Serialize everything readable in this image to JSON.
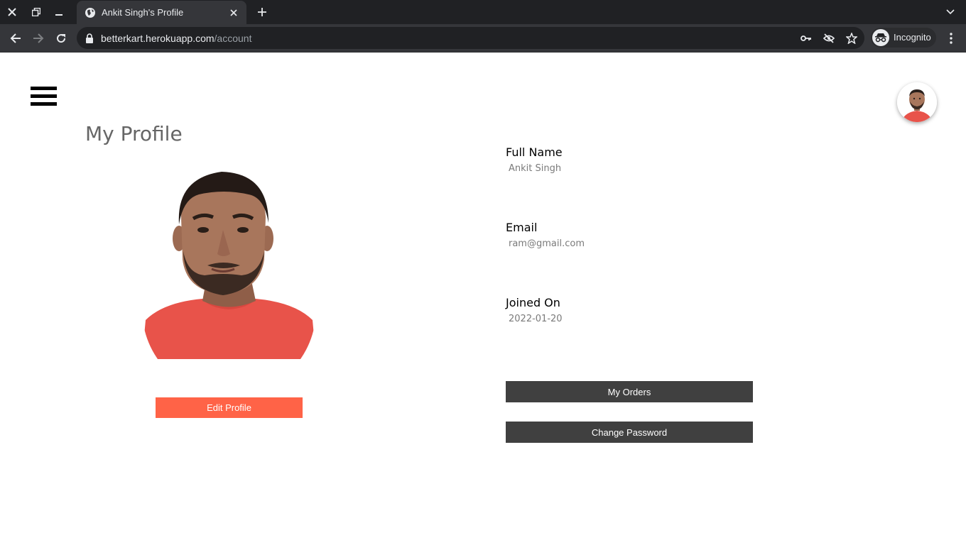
{
  "browser": {
    "tab_title": "Ankit Singh's Profile",
    "url_host": "betterkart.herokuapp.com",
    "url_path": "/account",
    "incognito_label": "Incognito",
    "icons": {
      "close_window": "close-icon",
      "restore": "restore-icon",
      "minimize": "minimize-icon",
      "favicon": "globe-icon",
      "tab_close": "close-icon",
      "new_tab": "plus-icon",
      "tab_menu": "chevron-down-icon",
      "back": "arrow-left-icon",
      "forward": "arrow-right-icon",
      "reload": "reload-icon",
      "lock": "lock-icon",
      "key": "key-icon",
      "tracking": "eye-off-icon",
      "bookmark": "star-icon",
      "incognito": "incognito-icon",
      "menu": "kebab-icon"
    }
  },
  "page": {
    "title": "My Profile",
    "edit_profile_label": "Edit Profile",
    "fields": [
      {
        "label": "Full Name",
        "value": "Ankit Singh"
      },
      {
        "label": "Email",
        "value": "ram@gmail.com"
      },
      {
        "label": "Joined On",
        "value": "2022-01-20"
      }
    ],
    "my_orders_label": "My Orders",
    "change_password_label": "Change Password"
  },
  "colors": {
    "accent": "#ff6347",
    "button_dark": "#404040",
    "title_gray": "#666666",
    "shirt": "#e8534a"
  }
}
